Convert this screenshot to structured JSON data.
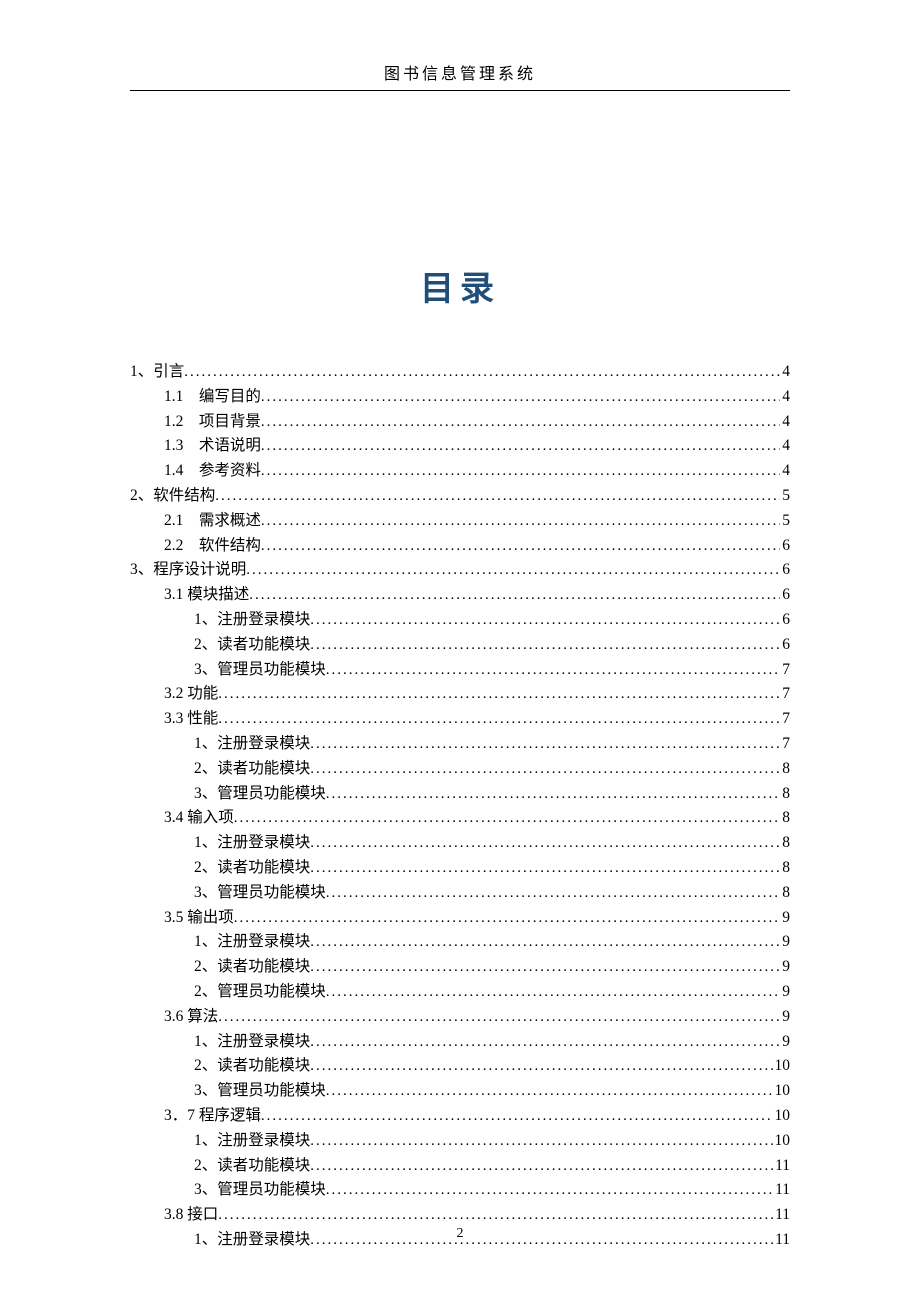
{
  "header": "图书信息管理系统",
  "title": "目录",
  "footer": "2",
  "toc": [
    {
      "level": 0,
      "label": "1、引言",
      "page": "4"
    },
    {
      "level": 1,
      "label": "1.1　编写目的",
      "page": "4",
      "wide": true
    },
    {
      "level": 1,
      "label": "1.2　项目背景",
      "page": "4",
      "wide": true
    },
    {
      "level": 1,
      "label": "1.3　术语说明",
      "page": "4",
      "wide": true
    },
    {
      "level": 1,
      "label": "1.4　参考资料",
      "page": "4",
      "wide": true
    },
    {
      "level": 0,
      "label": "2、软件结构",
      "page": "5"
    },
    {
      "level": 1,
      "label": "2.1　需求概述",
      "page": "5",
      "wide": true
    },
    {
      "level": 1,
      "label": "2.2　软件结构",
      "page": "6",
      "wide": true
    },
    {
      "level": 0,
      "label": "3、程序设计说明",
      "page": "6"
    },
    {
      "level": 1,
      "label": "3.1 模块描述",
      "page": "6"
    },
    {
      "level": 2,
      "label": "1、注册登录模块",
      "page": "6"
    },
    {
      "level": 2,
      "label": "2、读者功能模块",
      "page": "6"
    },
    {
      "level": 2,
      "label": "3、管理员功能模块",
      "page": "7"
    },
    {
      "level": 1,
      "label": "3.2 功能",
      "page": "7"
    },
    {
      "level": 1,
      "label": "3.3 性能",
      "page": "7"
    },
    {
      "level": 2,
      "label": "1、注册登录模块",
      "page": "7"
    },
    {
      "level": 2,
      "label": "2、读者功能模块",
      "page": "8"
    },
    {
      "level": 2,
      "label": "3、管理员功能模块",
      "page": "8"
    },
    {
      "level": 1,
      "label": "3.4 输入项",
      "page": "8"
    },
    {
      "level": 2,
      "label": "1、注册登录模块",
      "page": "8"
    },
    {
      "level": 2,
      "label": "2、读者功能模块",
      "page": "8"
    },
    {
      "level": 2,
      "label": "3、管理员功能模块",
      "page": "8"
    },
    {
      "level": 1,
      "label": "3.5 输出项",
      "page": "9"
    },
    {
      "level": 2,
      "label": "1、注册登录模块",
      "page": "9"
    },
    {
      "level": 2,
      "label": "2、读者功能模块",
      "page": "9"
    },
    {
      "level": 2,
      "label": "2、管理员功能模块",
      "page": "9"
    },
    {
      "level": 1,
      "label": "3.6 算法",
      "page": "9"
    },
    {
      "level": 2,
      "label": "1、注册登录模块",
      "page": "9"
    },
    {
      "level": 2,
      "label": "2、读者功能模块",
      "page": "10"
    },
    {
      "level": 2,
      "label": "3、管理员功能模块",
      "page": "10"
    },
    {
      "level": 1,
      "label": "3．7 程序逻辑",
      "page": "10"
    },
    {
      "level": 2,
      "label": "1、注册登录模块",
      "page": "10"
    },
    {
      "level": 2,
      "label": "2、读者功能模块",
      "page": "11"
    },
    {
      "level": 2,
      "label": "3、管理员功能模块",
      "page": "11"
    },
    {
      "level": 1,
      "label": "3.8 接口",
      "page": "11"
    },
    {
      "level": 2,
      "label": "1、注册登录模块",
      "page": "11"
    }
  ]
}
